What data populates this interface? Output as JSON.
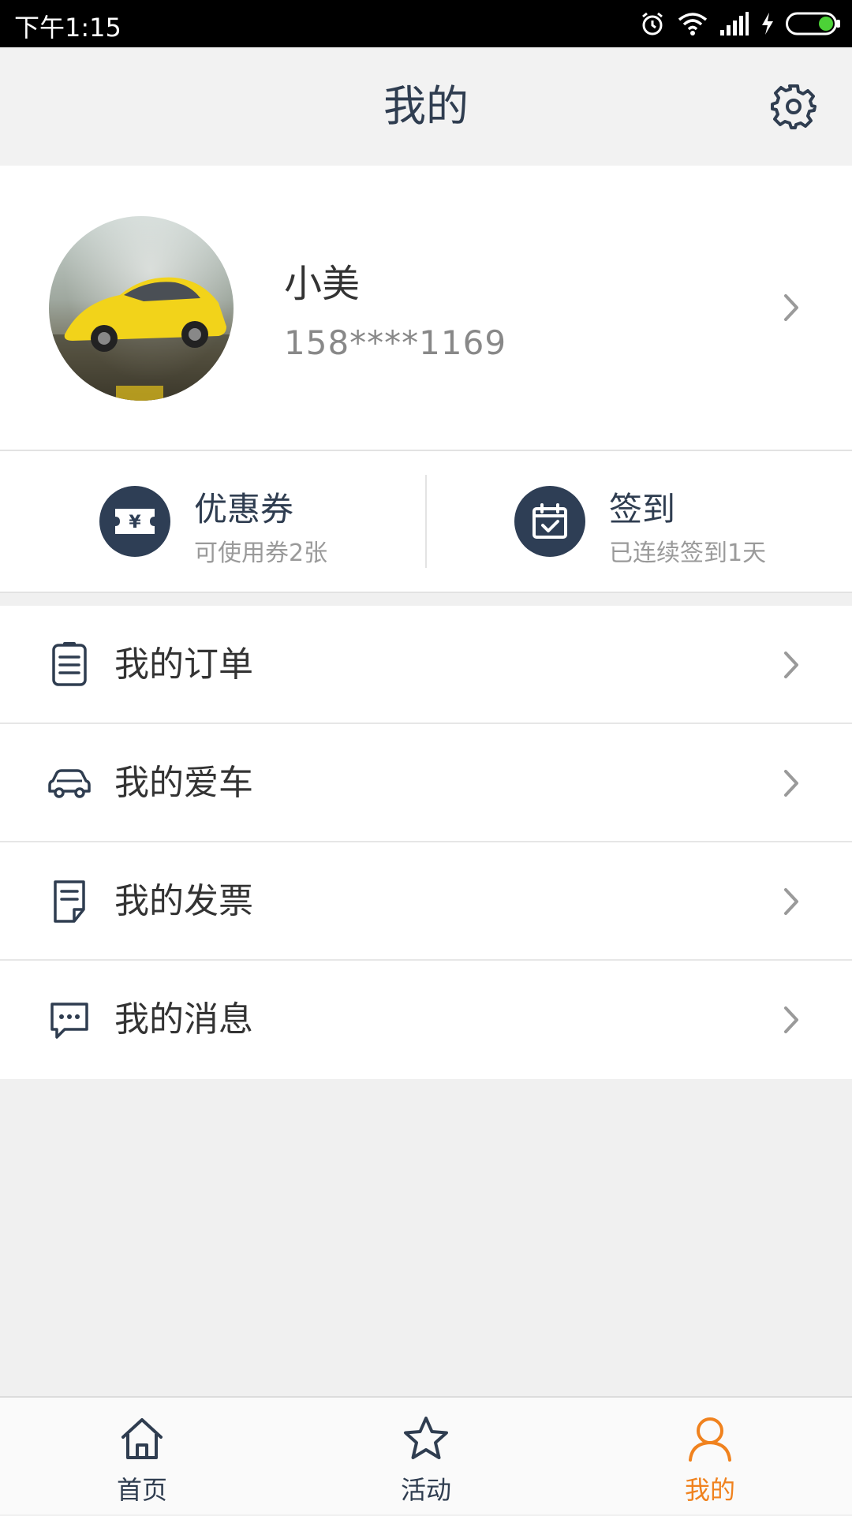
{
  "status_bar": {
    "time": "下午1:15"
  },
  "header": {
    "title": "我的"
  },
  "profile": {
    "name": "小美",
    "phone": "158****1169"
  },
  "quick_actions": [
    {
      "title": "优惠券",
      "subtitle": "可使用券2张",
      "icon": "coupon-yen-icon"
    },
    {
      "title": "签到",
      "subtitle": "已连续签到1天",
      "icon": "calendar-check-icon"
    }
  ],
  "menu": [
    {
      "label": "我的订单",
      "icon": "order-list-icon"
    },
    {
      "label": "我的爱车",
      "icon": "car-icon"
    },
    {
      "label": "我的发票",
      "icon": "invoice-icon"
    },
    {
      "label": "我的消息",
      "icon": "message-icon"
    }
  ],
  "tabs": [
    {
      "label": "首页",
      "icon": "home-icon"
    },
    {
      "label": "活动",
      "icon": "star-icon"
    },
    {
      "label": "我的",
      "icon": "user-icon",
      "active": true
    }
  ],
  "colors": {
    "navy": "#2e3e55",
    "accent_active": "#f0821e",
    "tab_inactive": "#2f3d50"
  }
}
